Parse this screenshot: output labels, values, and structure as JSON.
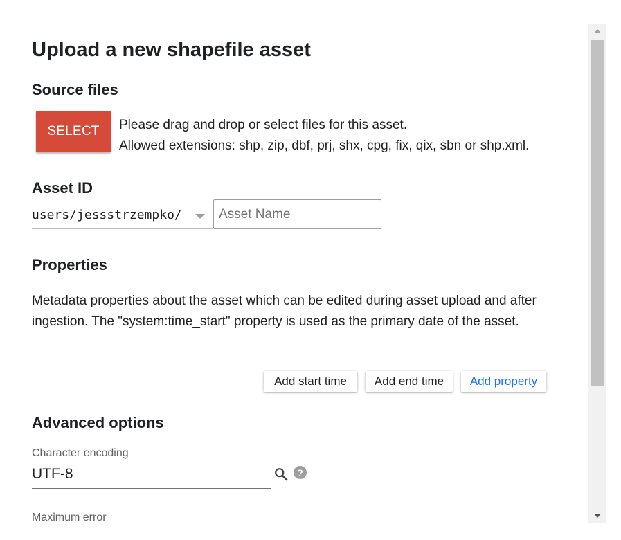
{
  "dialog": {
    "title": "Upload a new shapefile asset"
  },
  "source_files": {
    "heading": "Source files",
    "select_label": "SELECT",
    "instruction_line1": "Please drag and drop or select files for this asset.",
    "instruction_line2": "Allowed extensions: shp, zip, dbf, prj, shx, cpg, fix, qix, sbn or shp.xml."
  },
  "asset_id": {
    "heading": "Asset ID",
    "prefix": "users/jessstrzempko/",
    "name_placeholder": "Asset Name",
    "name_value": ""
  },
  "properties": {
    "heading": "Properties",
    "description": "Metadata properties about the asset which can be edited during asset upload and after ingestion. The \"system:time_start\" property is used as the primary date of the asset.",
    "add_start_time_label": "Add start time",
    "add_end_time_label": "Add end time",
    "add_property_label": "Add property"
  },
  "advanced": {
    "heading": "Advanced options",
    "encoding_label": "Character encoding",
    "encoding_value": "UTF-8",
    "help_glyph": "?",
    "max_error_label": "Maximum error"
  },
  "icons": {
    "dropdown": "chevron-down-icon",
    "search": "search-icon",
    "help": "help-icon"
  },
  "colors": {
    "select_button": "#d64a3a",
    "link_blue": "#1a73e8"
  }
}
